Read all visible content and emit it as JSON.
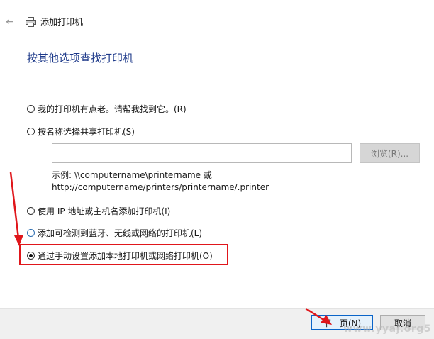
{
  "window": {
    "title": "添加打印机"
  },
  "page": {
    "heading": "按其他选项查找打印机"
  },
  "options": [
    {
      "label": "我的打印机有点老。请帮我找到它。(R)",
      "checked": false
    },
    {
      "label": "按名称选择共享打印机(S)",
      "checked": false
    },
    {
      "label": "使用 IP 地址或主机名添加打印机(I)",
      "checked": false
    },
    {
      "label": "添加可检测到蓝牙、无线或网络的打印机(L)",
      "checked": false
    },
    {
      "label": "通过手动设置添加本地打印机或网络打印机(O)",
      "checked": true
    }
  ],
  "share": {
    "input_value": "",
    "browse_label": "浏览(R)...",
    "example_line1": "示例: \\\\computername\\printername 或",
    "example_line2": "http://computername/printers/printername/.printer"
  },
  "footer": {
    "next_label": "下一页(N)",
    "cancel_label": "取消"
  },
  "annotation": {
    "color": "#e0161b"
  },
  "watermark": "www.yyaj.org5",
  "icons": {
    "back": "back-arrow-icon",
    "printer": "printer-icon"
  }
}
